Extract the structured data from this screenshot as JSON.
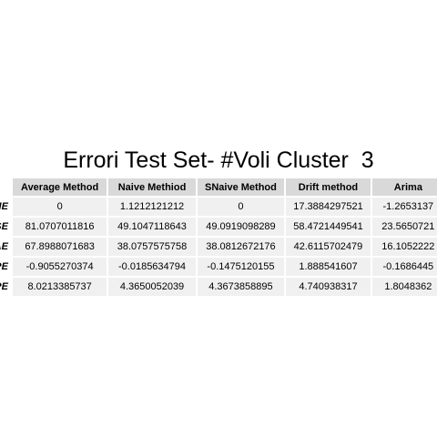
{
  "title": "Errori Test Set- #Voli Cluster  3",
  "columns": [
    "Average Method",
    "Naive Methiod",
    "SNaive Method",
    "Drift method",
    "Arima"
  ],
  "rows": [
    {
      "label": "ME",
      "values": [
        "0",
        "1.1212121212",
        "0",
        "17.3884297521",
        "-1.2653137"
      ]
    },
    {
      "label": "RMSE",
      "values": [
        "81.0707011816",
        "49.1047118643",
        "49.0919098289",
        "58.4721449541",
        "23.5650721"
      ]
    },
    {
      "label": "MAE",
      "values": [
        "67.8988071683",
        "38.0757575758",
        "38.0812672176",
        "42.6115702479",
        "16.1052222"
      ]
    },
    {
      "label": "MPE",
      "values": [
        "-0.9055270374",
        "-0.0185634794",
        "-0.1475120155",
        "1.888541607",
        "-0.1686445"
      ]
    },
    {
      "label": "MAPE",
      "values": [
        "8.0213385737",
        "4.3650052039",
        "4.3673858895",
        "4.740938317",
        "1.8048362"
      ]
    }
  ]
}
